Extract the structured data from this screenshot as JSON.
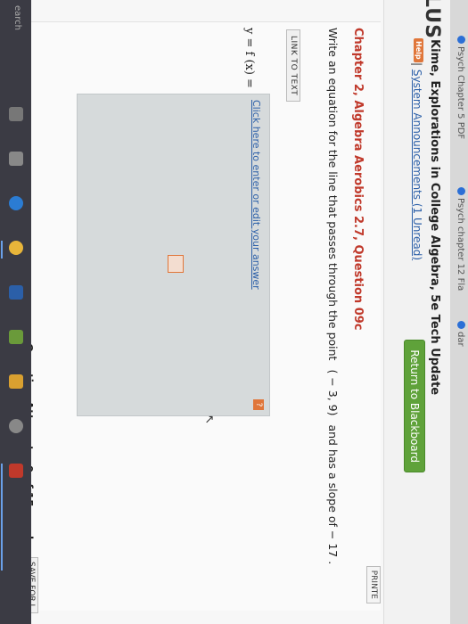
{
  "tabs": [
    {
      "label": "Psych Chapter 5 PDF"
    },
    {
      "label": "Psych chapter 12 Fla"
    },
    {
      "label": "dar"
    }
  ],
  "header": {
    "brand": "LUS",
    "course_title": "Kime, Explorations in College Algebra, 5e Tech Update",
    "help_badge": "Help",
    "sys_prefix": "| ",
    "sys_link": "System Announcements (1 Unread)",
    "return_button": "Return to Blackboard"
  },
  "content": {
    "print_button": "PRINTE",
    "chapter": "Chapter 2, Algebra Aerobics 2.7, Question 09c",
    "question_prefix": "Write an equation for the line that passes through the point",
    "point": "( − 3, 9)",
    "question_suffix": "and has a slope of  − 17 .",
    "link_to_text": "LINK TO TEXT",
    "equation_label": "y = f (x) =",
    "click_link": "Click here to enter or edit your answer",
    "help_q": "?",
    "attempts": "Question Attempts: 0 of 15 used",
    "save_button": "SAVE FOR L"
  },
  "taskbar": {
    "search": "earch"
  },
  "colors": {
    "accent_green": "#5fa23a",
    "chapter_red": "#c0392b",
    "help_orange": "#e0763a",
    "link_blue": "#2b5fa8"
  }
}
